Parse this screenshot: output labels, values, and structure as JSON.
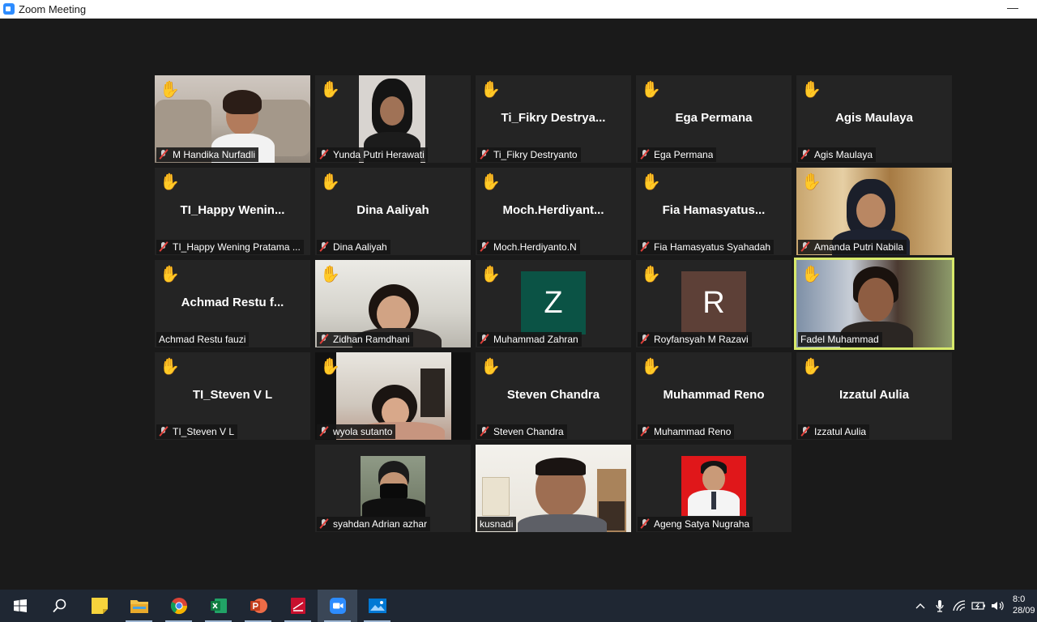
{
  "window": {
    "title": "Zoom Meeting",
    "minimize_glyph": "—"
  },
  "raise_hand_glyph": "✋",
  "participants": [
    {
      "name": "M Handika Nurfadli",
      "title": "",
      "muted": true
    },
    {
      "name": "Yunda Putri Herawati",
      "title": "",
      "muted": true
    },
    {
      "name": "Ti_Fikry Destryanto",
      "title": "Ti_Fikry  Destrya...",
      "muted": true
    },
    {
      "name": "Ega Permana",
      "title": "Ega Permana",
      "muted": true
    },
    {
      "name": "Agis Maulaya",
      "title": "Agis Maulaya",
      "muted": true
    },
    {
      "name": "TI_Happy Wening Pratama ...",
      "title": "TI_Happy  Wenin...",
      "muted": true
    },
    {
      "name": "Dina Aaliyah",
      "title": "Dina Aaliyah",
      "muted": true
    },
    {
      "name": "Moch.Herdiyanto.N",
      "title": "Moch.Herdiyant...",
      "muted": true
    },
    {
      "name": "Fia Hamasyatus Syahadah",
      "title": "Fia  Hamasyatus...",
      "muted": true
    },
    {
      "name": "Amanda Putri Nabila",
      "title": "",
      "muted": true
    },
    {
      "name": "Achmad Restu fauzi",
      "title": "Achmad Restu f...",
      "muted": false
    },
    {
      "name": "Zidhan Ramdhani",
      "title": "",
      "muted": true
    },
    {
      "name": "Muhammad Zahran",
      "title": "",
      "muted": true,
      "avatar_letter": "Z",
      "avatar_color": "#0b5345"
    },
    {
      "name": "Royfansyah M Razavi",
      "title": "",
      "muted": true,
      "avatar_letter": "R",
      "avatar_color": "#5d4037"
    },
    {
      "name": "Fadel Muhammad",
      "title": "",
      "muted": false,
      "active_speaker": true
    },
    {
      "name": "TI_Steven V L",
      "title": "TI_Steven V L",
      "muted": true
    },
    {
      "name": "wyola sutanto",
      "title": "",
      "muted": true
    },
    {
      "name": "Steven Chandra",
      "title": "Steven Chandra",
      "muted": true
    },
    {
      "name": "Muhammad Reno",
      "title": "Muhammad Reno",
      "muted": true
    },
    {
      "name": "Izzatul Aulia",
      "title": "Izzatul Aulia",
      "muted": true
    },
    {
      "name": "syahdan Adrian azhar",
      "title": "",
      "muted": true
    },
    {
      "name": "kusnadi",
      "title": "",
      "muted": false
    },
    {
      "name": "Ageng Satya Nugraha",
      "title": "",
      "muted": true
    }
  ],
  "taskbar": {
    "apps": [
      "start-icon",
      "search-icon",
      "sticky-notes-icon",
      "file-explorer-icon",
      "chrome-icon",
      "excel-icon",
      "powerpoint-icon",
      "pdf-reader-icon",
      "zoom-icon",
      "photos-icon"
    ],
    "clock_time": "8:0",
    "clock_date": "28/09",
    "tray_chevron": "^"
  },
  "colors": {
    "active_speaker_border": "#d7e96a",
    "raise_hand": "#f1c232",
    "mute_slash": "#e0403a"
  }
}
